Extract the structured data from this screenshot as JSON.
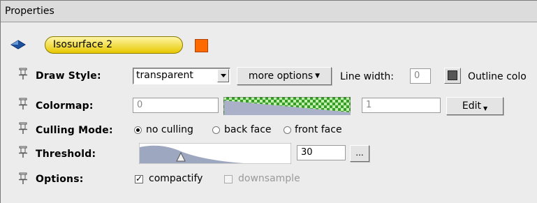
{
  "panel": {
    "title": "Properties"
  },
  "object": {
    "name": "Isosurface 2",
    "color": "#ff6a00"
  },
  "draw_style": {
    "label": "Draw Style:",
    "value": "transparent",
    "more_options": "more options",
    "line_width_label": "Line width:",
    "line_width_value": "0",
    "outline_label": "Outline colo"
  },
  "colormap": {
    "label": "Colormap:",
    "min": "0",
    "max": "1",
    "edit": "Edit"
  },
  "culling": {
    "label": "Culling Mode:",
    "options": [
      "no culling",
      "back face",
      "front face"
    ],
    "selected": "no culling"
  },
  "threshold": {
    "label": "Threshold:",
    "value": "30",
    "browse": "..."
  },
  "options": {
    "label": "Options:",
    "compactify": "compactify",
    "compactify_checked": true,
    "downsample": "downsample",
    "downsample_enabled": false
  },
  "icons": {
    "object": "diamond-icon",
    "pin": "pushpin-icon"
  }
}
